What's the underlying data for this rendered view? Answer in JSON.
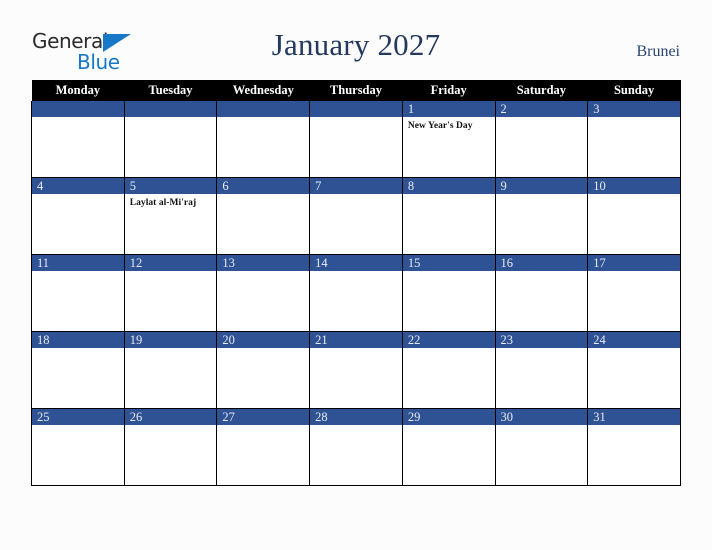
{
  "logo": {
    "word_one": "General",
    "word_two": "Blue",
    "triangle_icon": "triangle-icon",
    "accent_color": "#1878c8",
    "text_color": "#2b2b2b"
  },
  "header": {
    "title": "January 2027",
    "country": "Brunei",
    "title_color": "#23395d"
  },
  "calendar": {
    "month": "January",
    "year": "2027",
    "day_headers": [
      "Monday",
      "Tuesday",
      "Wednesday",
      "Thursday",
      "Friday",
      "Saturday",
      "Sunday"
    ],
    "header_bg": "#000000",
    "daybar_color": "#2e5293",
    "weeks": [
      [
        {
          "day": "",
          "events": []
        },
        {
          "day": "",
          "events": []
        },
        {
          "day": "",
          "events": []
        },
        {
          "day": "",
          "events": []
        },
        {
          "day": "1",
          "events": [
            "New Year's Day"
          ]
        },
        {
          "day": "2",
          "events": []
        },
        {
          "day": "3",
          "events": []
        }
      ],
      [
        {
          "day": "4",
          "events": []
        },
        {
          "day": "5",
          "events": [
            "Laylat al-Mi'raj"
          ]
        },
        {
          "day": "6",
          "events": []
        },
        {
          "day": "7",
          "events": []
        },
        {
          "day": "8",
          "events": []
        },
        {
          "day": "9",
          "events": []
        },
        {
          "day": "10",
          "events": []
        }
      ],
      [
        {
          "day": "11",
          "events": []
        },
        {
          "day": "12",
          "events": []
        },
        {
          "day": "13",
          "events": []
        },
        {
          "day": "14",
          "events": []
        },
        {
          "day": "15",
          "events": []
        },
        {
          "day": "16",
          "events": []
        },
        {
          "day": "17",
          "events": []
        }
      ],
      [
        {
          "day": "18",
          "events": []
        },
        {
          "day": "19",
          "events": []
        },
        {
          "day": "20",
          "events": []
        },
        {
          "day": "21",
          "events": []
        },
        {
          "day": "22",
          "events": []
        },
        {
          "day": "23",
          "events": []
        },
        {
          "day": "24",
          "events": []
        }
      ],
      [
        {
          "day": "25",
          "events": []
        },
        {
          "day": "26",
          "events": []
        },
        {
          "day": "27",
          "events": []
        },
        {
          "day": "28",
          "events": []
        },
        {
          "day": "29",
          "events": []
        },
        {
          "day": "30",
          "events": []
        },
        {
          "day": "31",
          "events": []
        }
      ]
    ]
  }
}
